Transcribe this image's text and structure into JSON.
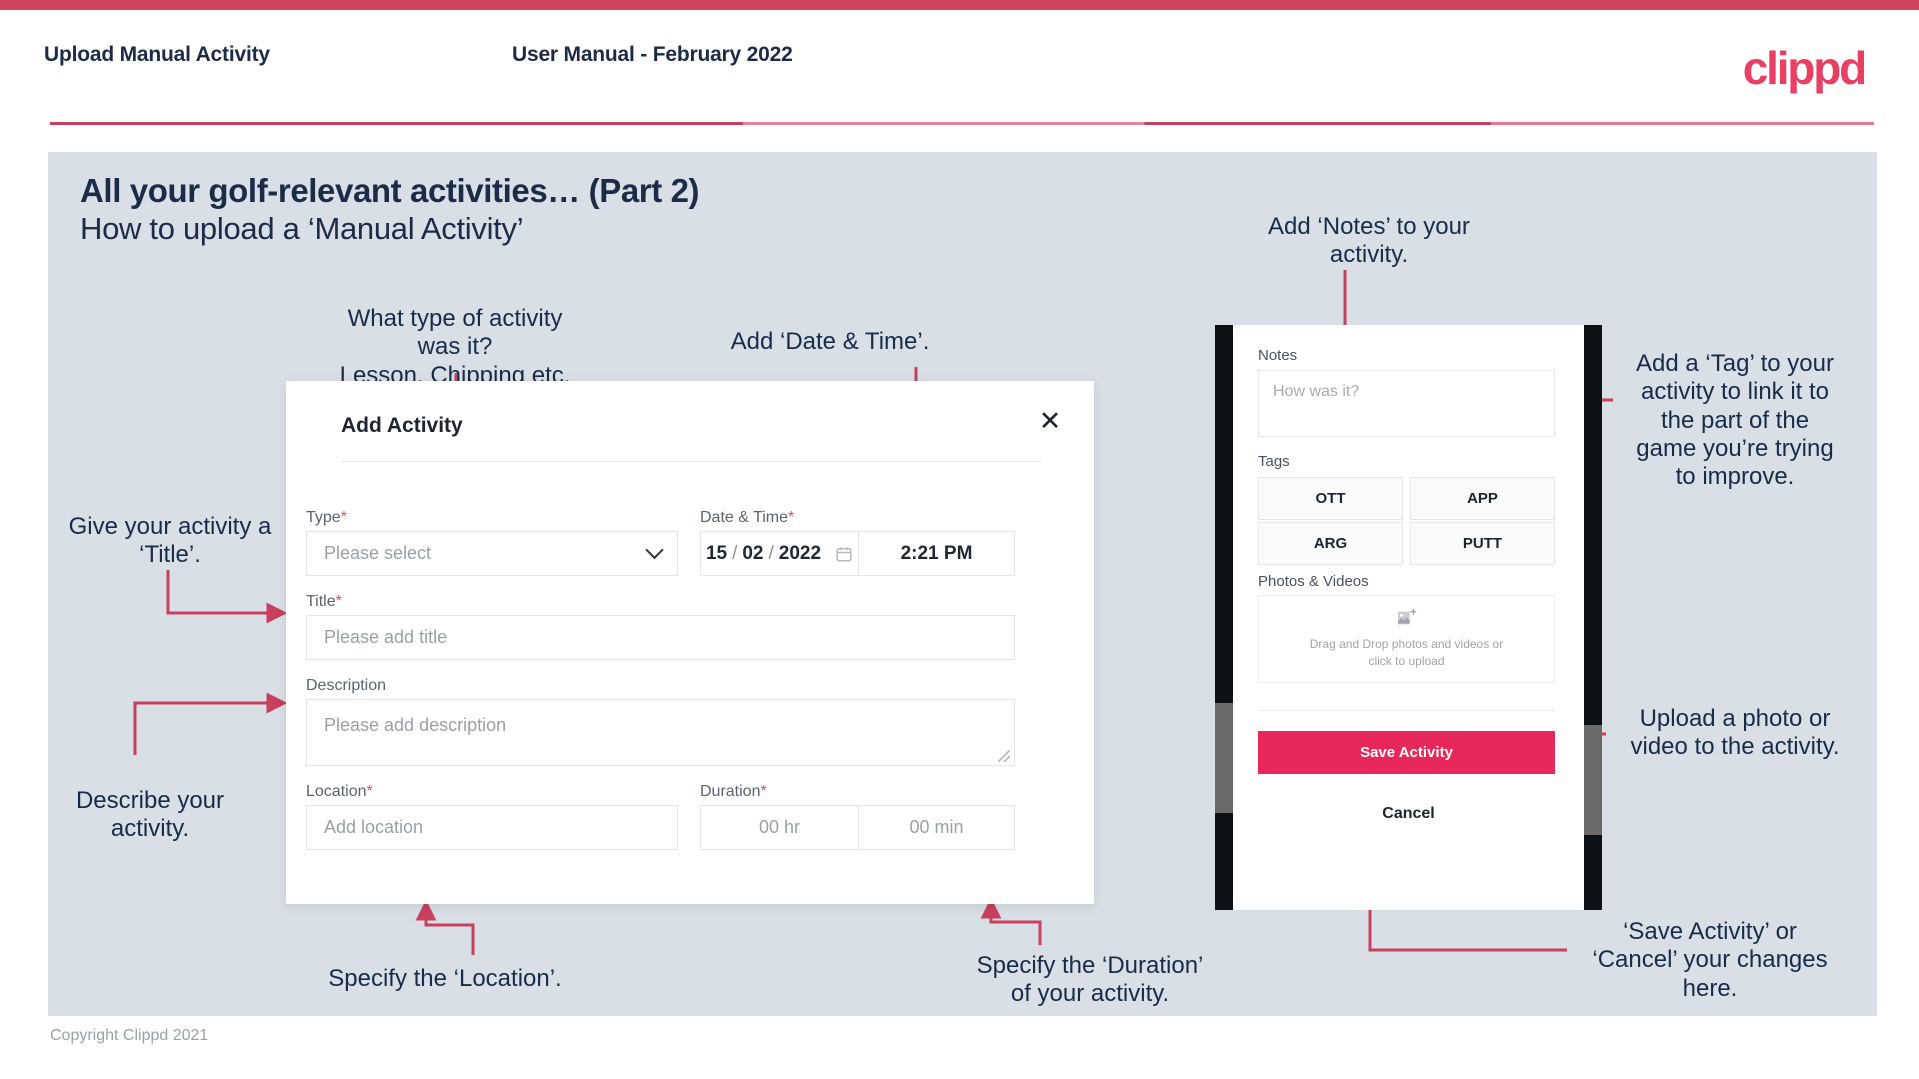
{
  "header": {
    "left_title": "Upload Manual Activity",
    "center_title": "User Manual - February 2022",
    "logo": "clippd"
  },
  "slide": {
    "title": "All your golf-relevant activities… (Part 2)",
    "subtitle": "How to upload a ‘Manual Activity’"
  },
  "footer": {
    "copyright": "Copyright Clippd 2021"
  },
  "annotations": {
    "type": "What type of activity was it?\nLesson, Chipping etc.",
    "datetime": "Add ‘Date & Time’.",
    "title": "Give your activity a\n‘Title’.",
    "description": "Describe your\nactivity.",
    "location": "Specify the ‘Location’.",
    "duration": "Specify the ‘Duration’\nof your activity.",
    "notes": "Add ‘Notes’ to your\nactivity.",
    "tags": "Add a ‘Tag’ to your\nactivity to link it to\nthe part of the\ngame you’re trying\nto improve.",
    "photos": "Upload a photo or\nvideo to the activity.",
    "save_cancel": "‘Save Activity’ or\n‘Cancel’ your changes\nhere."
  },
  "modal": {
    "title": "Add Activity",
    "close_icon": "close-icon",
    "fields": {
      "type": {
        "label": "Type",
        "required": "*",
        "value": "",
        "placeholder": "Please select"
      },
      "datetime": {
        "label": "Date & Time",
        "required": "*",
        "day": "15",
        "month": "02",
        "year": "2022",
        "sep": "/",
        "time": "2:21 PM"
      },
      "title": {
        "label": "Title",
        "required": "*",
        "value": "",
        "placeholder": "Please add title"
      },
      "description": {
        "label": "Description",
        "required": "",
        "value": "",
        "placeholder": "Please add description"
      },
      "location": {
        "label": "Location",
        "required": "*",
        "value": "",
        "placeholder": "Add location"
      },
      "duration": {
        "label": "Duration",
        "required": "*",
        "hours_placeholder": "00 hr",
        "minutes_placeholder": "00 min"
      }
    }
  },
  "phone": {
    "notes": {
      "label": "Notes",
      "placeholder": "How was it?"
    },
    "tags": {
      "label": "Tags",
      "items": [
        "OTT",
        "APP",
        "ARG",
        "PUTT"
      ]
    },
    "photos": {
      "label": "Photos & Videos",
      "icon": "add-image-icon",
      "dropzone_line1": "Drag and Drop photos and videos or",
      "dropzone_line2": "click to upload"
    },
    "save_label": "Save Activity",
    "cancel_label": "Cancel"
  },
  "colors": {
    "brand_pink": "#e83f62",
    "accent_red": "#cf445f",
    "slide_bg": "#d9dfe7",
    "ink": "#1c2b46",
    "save_btn": "#e8285a"
  }
}
